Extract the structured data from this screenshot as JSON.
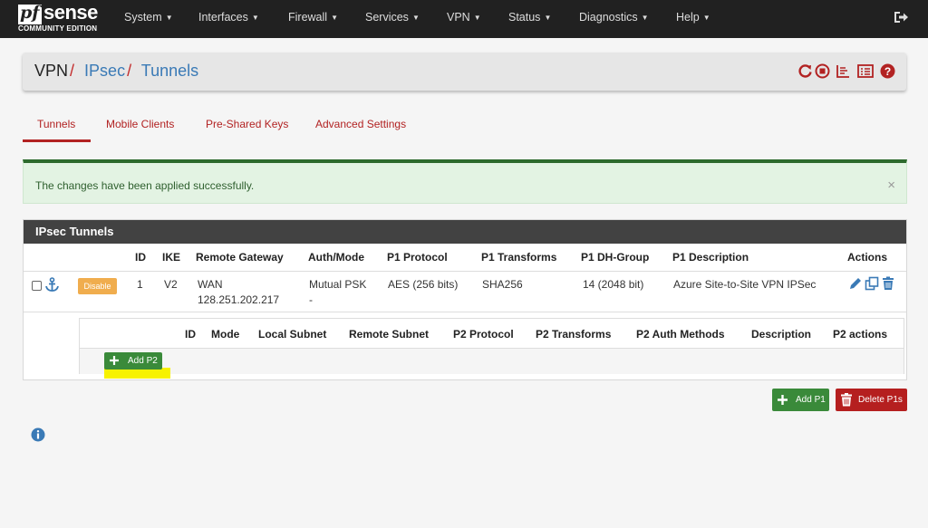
{
  "brand": {
    "logo_left": "pf",
    "logo_right": "sense",
    "edition": "COMMUNITY EDITION"
  },
  "nav": {
    "items": [
      "System",
      "Interfaces",
      "Firewall",
      "Services",
      "VPN",
      "Status",
      "Diagnostics",
      "Help"
    ],
    "logout_icon": "sign-out-icon"
  },
  "breadcrumb": {
    "root": "VPN",
    "section": "IPsec",
    "page": "Tunnels",
    "separator": "/"
  },
  "header_icons": [
    "restart-icon",
    "stop-icon",
    "logs-icon",
    "list-icon",
    "help-icon"
  ],
  "tabs": [
    "Tunnels",
    "Mobile Clients",
    "Pre-Shared Keys",
    "Advanced Settings"
  ],
  "alert": {
    "message": "The changes have been applied successfully.",
    "close": "×"
  },
  "panel": {
    "title": "IPsec Tunnels",
    "columns": [
      "ID",
      "IKE",
      "Remote Gateway",
      "Auth/Mode",
      "P1 Protocol",
      "P1 Transforms",
      "P1 DH-Group",
      "P1 Description",
      "Actions"
    ],
    "row": {
      "disable_label": "Disable",
      "id": "1",
      "ike": "V2",
      "gateway_iface": "WAN",
      "gateway_ip": "128.251.202.217",
      "auth": "Mutual PSK",
      "mode": "-",
      "protocol": "AES (256 bits)",
      "transforms": "SHA256",
      "dh_group": "14 (2048 bit)",
      "description": "Azure Site-to-Site VPN IPSec"
    },
    "p2_columns": [
      "ID",
      "Mode",
      "Local Subnet",
      "Remote Subnet",
      "P2 Protocol",
      "P2 Transforms",
      "P2 Auth Methods",
      "Description",
      "P2 actions"
    ],
    "add_p2_label": "Add P2"
  },
  "buttons": {
    "add_p1": "Add P1",
    "delete_p1s": "Delete P1s"
  },
  "colors": {
    "accent": "#b22222",
    "link": "#3a7ab6",
    "success": "#3a8a3a",
    "danger": "#b51f1f",
    "warning": "#f0ad4e",
    "navbar": "#212121"
  }
}
